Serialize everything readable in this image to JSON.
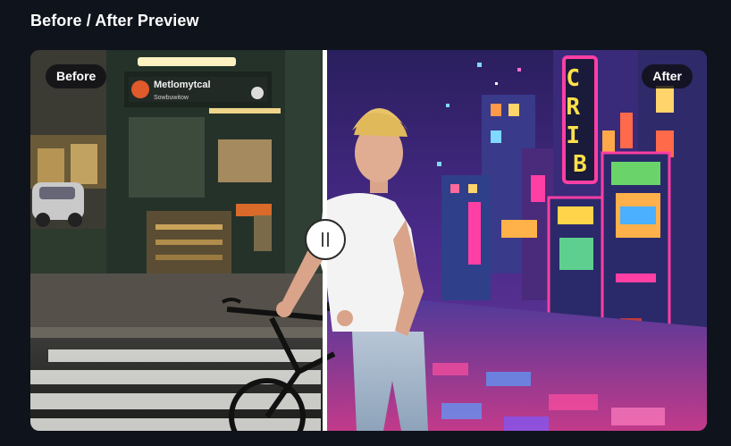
{
  "header": {
    "title": "Before / After Preview"
  },
  "comparison": {
    "before_label": "Before",
    "after_label": "After",
    "slider_position_pct": 43.8
  },
  "before_scene": {
    "sign_main": "Metlomytcal",
    "sign_sub": "Sowbuwitow"
  },
  "after_scene": {
    "neon_sign": "CRIB",
    "colors": {
      "neon_pink": "#ff3fa4",
      "neon_yellow": "#ffe04a",
      "sky": "#3a2a7a"
    }
  }
}
